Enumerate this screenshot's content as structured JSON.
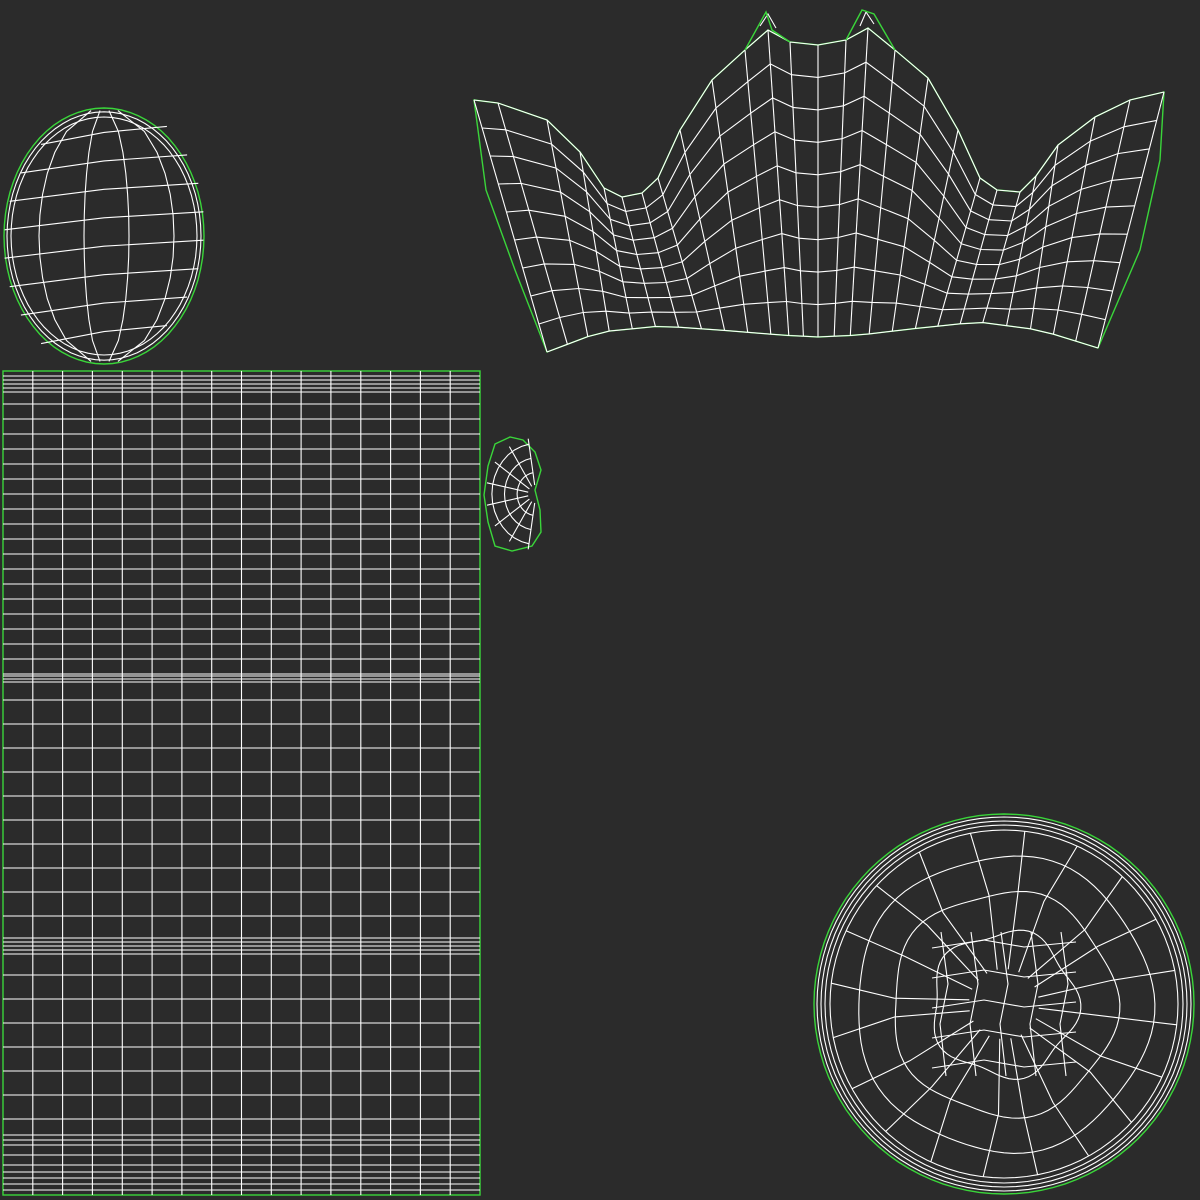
{
  "uv_layout": {
    "background_color": "#2b2b2b",
    "wire_color": "#ffffff",
    "border_color": "#3ad53a",
    "islands": [
      {
        "name": "oval-island",
        "shape": "ellipse"
      },
      {
        "name": "crown-island",
        "shape": "crown"
      },
      {
        "name": "strip-island",
        "shape": "rectangle"
      },
      {
        "name": "small-cap-island",
        "shape": "cap"
      },
      {
        "name": "disc-island",
        "shape": "disc"
      }
    ]
  }
}
